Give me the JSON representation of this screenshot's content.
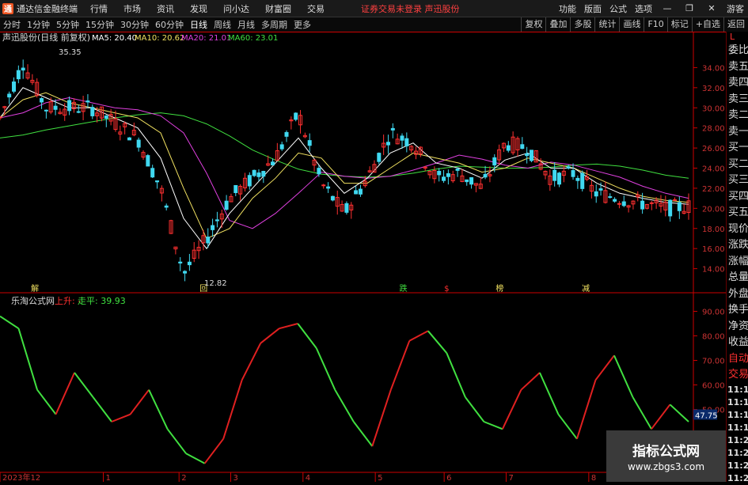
{
  "app": {
    "title": "通达信金融终端"
  },
  "menu": [
    "行情",
    "市场",
    "资讯",
    "发现",
    "问小达",
    "财富圈",
    "交易"
  ],
  "notice": "证券交易未登录  声迅股份",
  "right_menu": [
    "功能",
    "版面",
    "公式",
    "选项",
    "游客"
  ],
  "periods": [
    "分时",
    "1分钟",
    "5分钟",
    "15分钟",
    "30分钟",
    "60分钟",
    "日线",
    "周线",
    "月线",
    "多周期",
    "更多"
  ],
  "active_period": "日线",
  "tools": [
    "复权",
    "叠加",
    "多股",
    "统计",
    "画线",
    "F10",
    "标记",
    "+自选",
    "返回"
  ],
  "side": {
    "top": "L",
    "items": [
      "委比",
      "卖五",
      "卖四",
      "卖三",
      "卖二",
      "卖一",
      "买一",
      "买二",
      "买三",
      "买四",
      "买五",
      "现价",
      "涨跌",
      "涨幅",
      "总量",
      "外盘",
      "换手",
      "净资",
      "收益"
    ],
    "items2": [
      "自动",
      "交易"
    ],
    "times": [
      "11:19",
      "11:19",
      "11:19",
      "11:19",
      "11:20",
      "11:20",
      "11:20",
      "11:20"
    ]
  },
  "main_title": "声迅股份(日线 前复权)",
  "ma": [
    {
      "label": "MA5: 20.40",
      "color": "#ffffff"
    },
    {
      "label": "MA10: 20.62",
      "color": "#f0e060"
    },
    {
      "label": "MA20: 21.01",
      "color": "#e040e0"
    },
    {
      "label": "MA60: 23.01",
      "color": "#40e040"
    }
  ],
  "price_axis": [
    "34.00",
    "32.00",
    "30.00",
    "28.00",
    "26.00",
    "24.00",
    "22.00",
    "20.00",
    "18.00",
    "16.00",
    "14.00"
  ],
  "high_label": "35.35",
  "low_label": "12.82",
  "events": [
    "解",
    "回",
    "跌",
    "$",
    "榜",
    "减"
  ],
  "sub_title": "乐淘公式网",
  "sub_up": "上升: -",
  "sub_flat": "走平: 39.93",
  "sub_axis": [
    "90.00",
    "80.00",
    "70.00",
    "60.00",
    "50.00",
    "40.00",
    "30.00"
  ],
  "sub_current": "47.75",
  "date_axis": [
    "2023年12",
    "1",
    "2",
    "3",
    "4",
    "5",
    "6",
    "7",
    "8"
  ],
  "watermark": {
    "line1": "指标公式网",
    "line2": "www.zbgs3.com"
  },
  "chart_data": {
    "type": "line",
    "title": "声迅股份(日线 前复权)",
    "ylim": [
      12,
      36
    ],
    "series": [
      {
        "name": "MA60",
        "values": [
          27.0,
          27.3,
          27.8,
          28.2,
          28.6,
          29.0,
          29.3,
          29.5,
          29.2,
          28.4,
          27.2,
          25.8,
          24.8,
          23.9,
          23.4,
          23.2,
          23.1,
          23.2,
          23.5,
          23.9,
          24.2,
          24.1,
          24.0,
          24.0,
          24.1,
          24.3,
          24.4,
          24.2,
          23.8,
          23.3,
          23.0
        ]
      },
      {
        "name": "MA20",
        "values": [
          29.0,
          29.5,
          30.5,
          31.0,
          30.5,
          30.0,
          29.8,
          29.2,
          27.5,
          23.5,
          18.8,
          18.0,
          19.5,
          21.5,
          23.6,
          23.2,
          23.0,
          23.2,
          23.8,
          24.5,
          25.3,
          24.9,
          24.3,
          24.0,
          24.6,
          24.3,
          23.7,
          23.1,
          22.2,
          21.5,
          21.0
        ]
      },
      {
        "name": "MA10",
        "values": [
          29.0,
          30.8,
          31.5,
          30.5,
          30.0,
          29.5,
          29.0,
          27.5,
          22.0,
          17.0,
          18.0,
          21.0,
          23.0,
          25.5,
          25.0,
          22.5,
          22.5,
          24.0,
          25.5,
          25.0,
          24.5,
          23.6,
          24.0,
          25.0,
          24.5,
          24.0,
          23.0,
          22.0,
          21.2,
          20.8,
          20.6
        ]
      },
      {
        "name": "MA5",
        "values": [
          29.0,
          32.0,
          31.0,
          30.0,
          30.0,
          29.0,
          28.0,
          25.0,
          19.0,
          16.0,
          19.5,
          22.0,
          24.5,
          27.0,
          24.0,
          21.5,
          23.0,
          25.5,
          26.5,
          24.5,
          24.0,
          23.0,
          24.8,
          25.5,
          24.0,
          24.0,
          22.5,
          21.5,
          21.0,
          20.6,
          20.4
        ]
      },
      {
        "name": "K",
        "values": [
          29.0,
          34.5,
          30.0,
          30.0,
          30.0,
          28.5,
          27.0,
          22.0,
          13.5,
          17.0,
          21.0,
          23.0,
          25.0,
          29.5,
          22.5,
          19.5,
          23.0,
          27.5,
          26.5,
          23.0,
          23.5,
          22.0,
          26.5,
          26.0,
          23.0,
          23.5,
          21.5,
          21.0,
          20.5,
          20.0,
          20.2
        ]
      }
    ],
    "indicator": {
      "name": "乐淘公式网",
      "ylim": [
        25,
        95
      ],
      "values": [
        88,
        83,
        58,
        48,
        65,
        55,
        45,
        48,
        58,
        42,
        32,
        28,
        38,
        62,
        77,
        83,
        85,
        75,
        58,
        45,
        35,
        58,
        78,
        82,
        73,
        55,
        45,
        42,
        58,
        65,
        48,
        38,
        62,
        72,
        55,
        42,
        52,
        45
      ]
    },
    "high": 35.35,
    "low": 12.82
  }
}
